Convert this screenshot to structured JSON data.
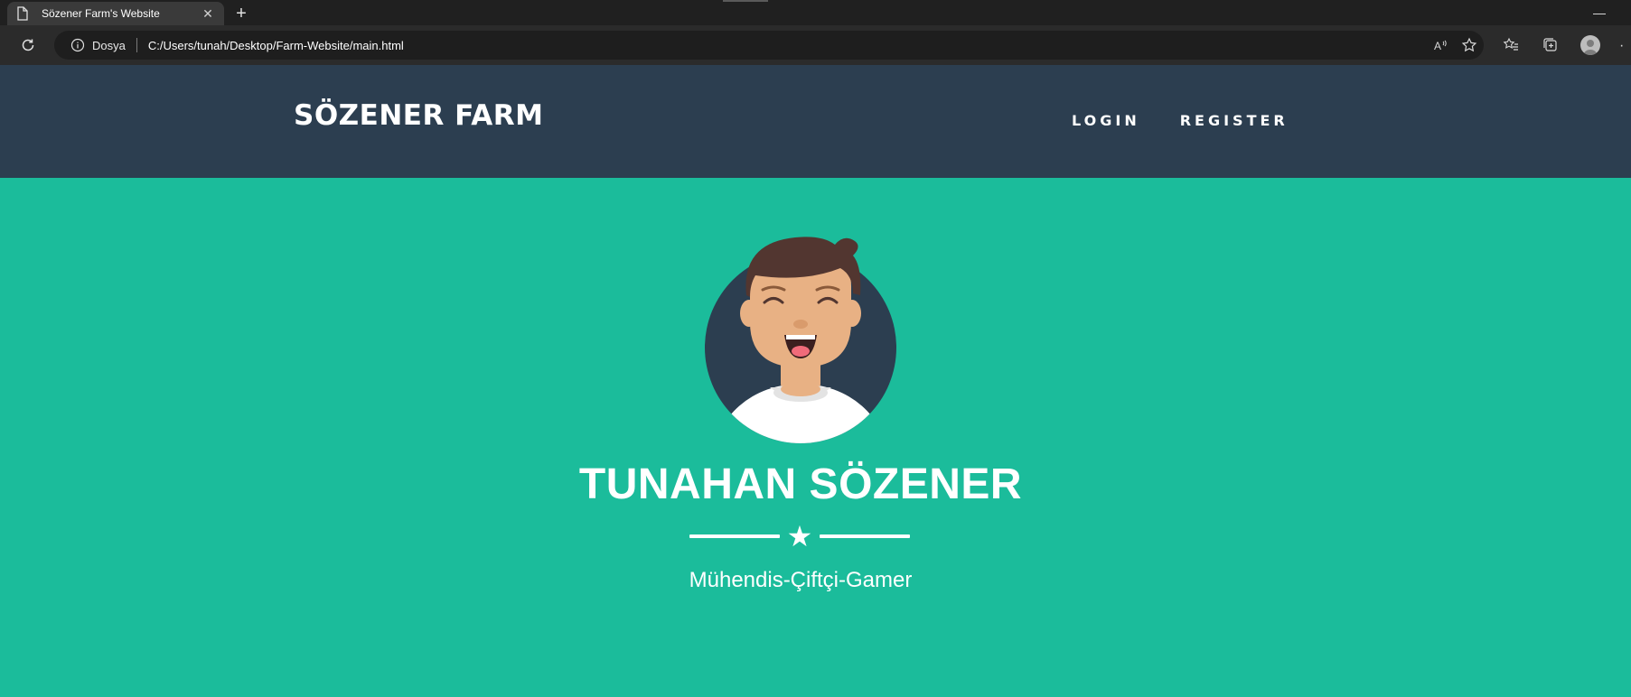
{
  "browser": {
    "tab_title": "Sözener Farm's Website",
    "address": {
      "protocol_label": "Dosya",
      "url": "C:/Users/tunah/Desktop/Farm-Website/main.html"
    }
  },
  "navbar": {
    "brand": "SÖZENER FARM",
    "links": [
      {
        "label": "LOGIN"
      },
      {
        "label": "REGISTER"
      }
    ]
  },
  "hero": {
    "name": "TUNAHAN SÖZENER",
    "subtitle": "Mühendis-Çiftçi-Gamer",
    "divider_icon": "star-icon"
  },
  "colors": {
    "navbar_bg": "#2c3e50",
    "hero_bg": "#1bbc9b",
    "text": "#ffffff"
  }
}
